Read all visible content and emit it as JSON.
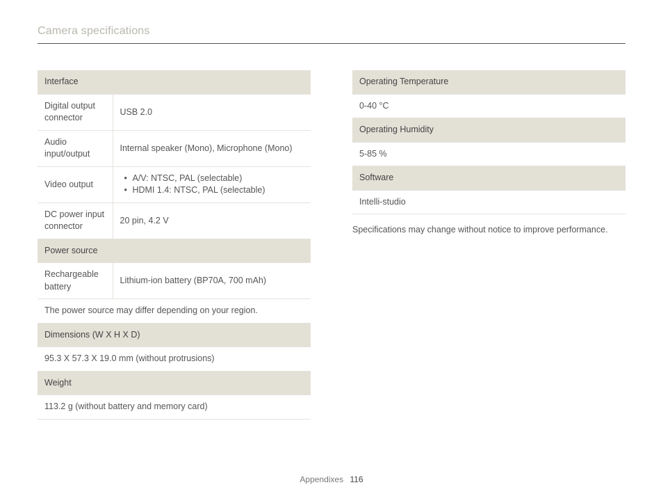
{
  "page_title": "Camera specifications",
  "left_table": {
    "sections": [
      {
        "header": "Interface",
        "rows": [
          {
            "label": "Digital output connector",
            "value": "USB 2.0"
          },
          {
            "label": "Audio input/output",
            "value": "Internal speaker (Mono), Microphone (Mono)"
          },
          {
            "label": "Video output",
            "list": [
              "A/V: NTSC, PAL (selectable)",
              "HDMI 1.4: NTSC, PAL (selectable)"
            ]
          },
          {
            "label": "DC power input connector",
            "value": "20 pin, 4.2 V"
          }
        ]
      },
      {
        "header": "Power source",
        "rows": [
          {
            "label": "Rechargeable battery",
            "value": "Lithium-ion battery (BP70A, 700 mAh)"
          },
          {
            "full": "The power source may differ depending on your region."
          }
        ]
      },
      {
        "header": "Dimensions (W X H X D)",
        "rows": [
          {
            "full": "95.3 X 57.3 X 19.0 mm (without protrusions)"
          }
        ]
      },
      {
        "header": "Weight",
        "rows": [
          {
            "full": "113.2 g (without battery and memory card)"
          }
        ]
      }
    ]
  },
  "right_table": {
    "sections": [
      {
        "header": "Operating Temperature",
        "rows": [
          {
            "full": "0-40 °C"
          }
        ]
      },
      {
        "header": "Operating Humidity",
        "rows": [
          {
            "full": "5-85 %"
          }
        ]
      },
      {
        "header": "Software",
        "rows": [
          {
            "full": "Intelli-studio"
          }
        ]
      }
    ]
  },
  "right_note": "Specifications may change without notice to improve performance.",
  "footer": {
    "section": "Appendixes",
    "page": "116"
  }
}
